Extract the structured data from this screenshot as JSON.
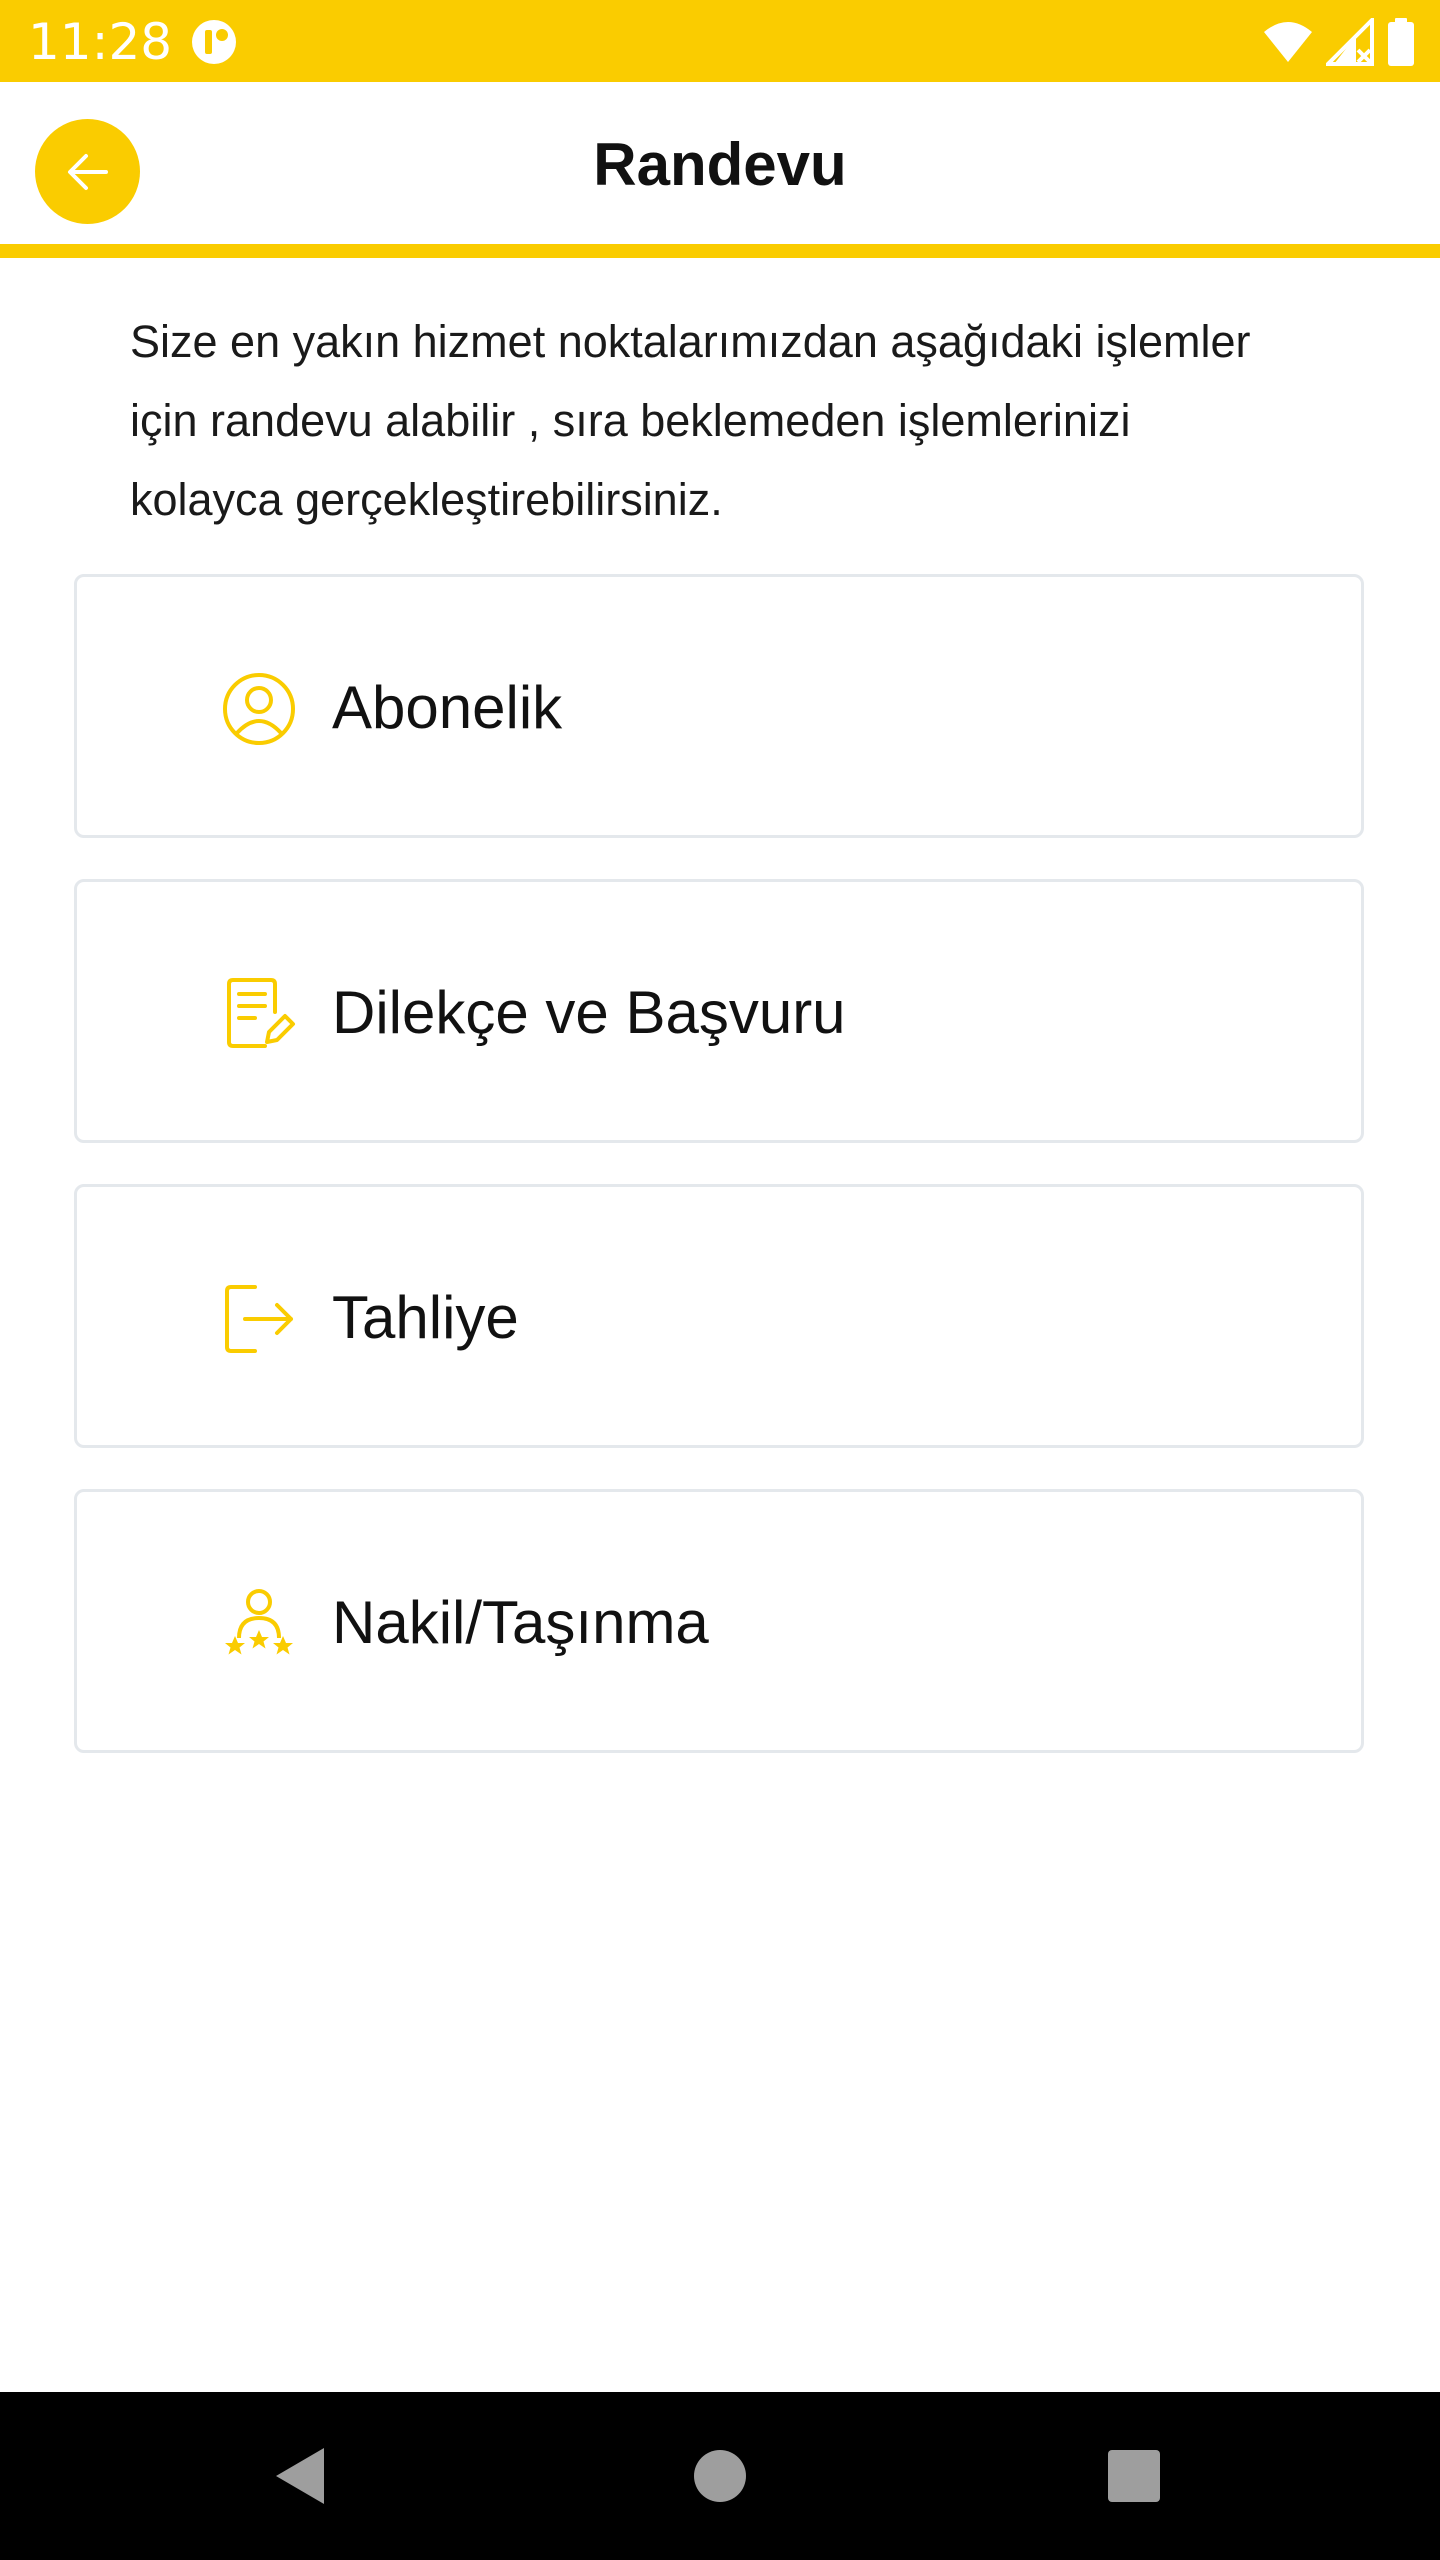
{
  "status_bar": {
    "time": "11:28",
    "background_color": "#FACC00",
    "icons": [
      "app-notification-icon",
      "wifi-icon",
      "signal-icon",
      "battery-icon"
    ]
  },
  "app_bar": {
    "title": "Randevu",
    "back_icon": "arrow-left-icon",
    "accent_color": "#FACC00"
  },
  "intro": {
    "line1": "Size en yakın hizmet noktalarımızdan aşağıdaki işlemler",
    "line2": "için randevu alabilir , sıra beklemeden işlemlerinizi",
    "line3": "kolayca gerçekleştirebilirsiniz."
  },
  "options": [
    {
      "label": "Abonelik",
      "icon": "user-circle-icon"
    },
    {
      "label": "Dilekçe ve Başvuru",
      "icon": "document-edit-icon"
    },
    {
      "label": "Tahliye",
      "icon": "exit-icon"
    },
    {
      "label": "Nakil/Taşınma",
      "icon": "user-stars-icon"
    }
  ],
  "nav_bar": {
    "buttons": [
      "back-triangle-icon",
      "home-circle-icon",
      "recents-square-icon"
    ]
  },
  "colors": {
    "accent": "#FACC00",
    "card_border": "#E4E8EC",
    "text": "#111111"
  }
}
